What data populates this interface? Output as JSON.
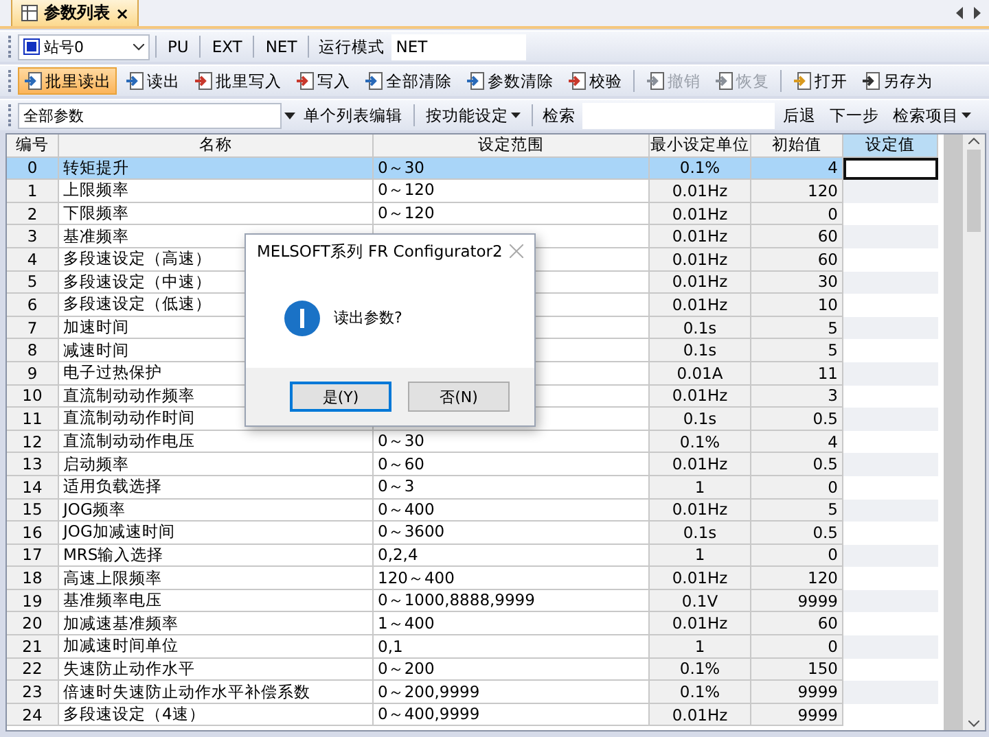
{
  "tab": {
    "title": "参数列表",
    "close": "×"
  },
  "mode_bar": {
    "station": "站号0",
    "modes": [
      "PU",
      "EXT",
      "NET"
    ],
    "mode_label": "运行模式",
    "mode_value": "NET"
  },
  "actions": [
    {
      "label": "批里读出",
      "selected": true,
      "disabled": false
    },
    {
      "label": "读出",
      "selected": false,
      "disabled": false
    },
    {
      "label": "批里写入",
      "selected": false,
      "disabled": false
    },
    {
      "label": "写入",
      "selected": false,
      "disabled": false
    },
    {
      "label": "全部清除",
      "selected": false,
      "disabled": false
    },
    {
      "label": "参数清除",
      "selected": false,
      "disabled": false
    },
    {
      "label": "校验",
      "selected": false,
      "disabled": false
    },
    {
      "label": "撤销",
      "selected": false,
      "disabled": true
    },
    {
      "label": "恢复",
      "selected": false,
      "disabled": true
    },
    {
      "label": "打开",
      "selected": false,
      "disabled": false
    },
    {
      "label": "另存为",
      "selected": false,
      "disabled": false
    }
  ],
  "filter_bar": {
    "group": "全部参数",
    "list_edit": "单个列表编辑",
    "by_function": "按功能设定",
    "search_label": "检索",
    "back": "后退",
    "next": "下一步",
    "search_items": "检索项目"
  },
  "table": {
    "columns": [
      "编号",
      "名称",
      "设定范围",
      "最小设定单位",
      "初始值",
      "设定值"
    ],
    "rows": [
      {
        "no": "0",
        "name": "转矩提升",
        "range": "0～30",
        "unit": "0.1%",
        "initial": "4",
        "selected": true
      },
      {
        "no": "1",
        "name": "上限频率",
        "range": "0～120",
        "unit": "0.01Hz",
        "initial": "120",
        "selected": false
      },
      {
        "no": "2",
        "name": "下限频率",
        "range": "0～120",
        "unit": "0.01Hz",
        "initial": "0",
        "selected": false
      },
      {
        "no": "3",
        "name": "基准频率",
        "unit": "0.01Hz",
        "initial": "60",
        "selected": false
      },
      {
        "no": "4",
        "name": "多段速设定（高速）",
        "unit": "0.01Hz",
        "initial": "60",
        "selected": false
      },
      {
        "no": "5",
        "name": "多段速设定（中速）",
        "unit": "0.01Hz",
        "initial": "30",
        "selected": false
      },
      {
        "no": "6",
        "name": "多段速设定（低速）",
        "unit": "0.01Hz",
        "initial": "10",
        "selected": false
      },
      {
        "no": "7",
        "name": "加速时间",
        "unit": "0.1s",
        "initial": "5",
        "selected": false
      },
      {
        "no": "8",
        "name": "减速时间",
        "unit": "0.1s",
        "initial": "5",
        "selected": false
      },
      {
        "no": "9",
        "name": "电子过热保护",
        "unit": "0.01A",
        "initial": "11",
        "selected": false
      },
      {
        "no": "10",
        "name": "直流制动动作频率",
        "unit": "0.01Hz",
        "initial": "3",
        "selected": false
      },
      {
        "no": "11",
        "name": "直流制动动作时间",
        "unit": "0.1s",
        "initial": "0.5",
        "selected": false
      },
      {
        "no": "12",
        "name": "直流制动动作电压",
        "range": "0～30",
        "unit": "0.1%",
        "initial": "4",
        "selected": false
      },
      {
        "no": "13",
        "name": "启动频率",
        "range": "0～60",
        "unit": "0.01Hz",
        "initial": "0.5",
        "selected": false
      },
      {
        "no": "14",
        "name": "适用负载选择",
        "range": "0～3",
        "unit": "1",
        "initial": "0",
        "selected": false
      },
      {
        "no": "15",
        "name": "JOG频率",
        "range": "0～400",
        "unit": "0.01Hz",
        "initial": "5",
        "selected": false
      },
      {
        "no": "16",
        "name": "JOG加减速时间",
        "range": "0～3600",
        "unit": "0.1s",
        "initial": "0.5",
        "selected": false
      },
      {
        "no": "17",
        "name": "MRS输入选择",
        "range": "0,2,4",
        "unit": "1",
        "initial": "0",
        "selected": false
      },
      {
        "no": "18",
        "name": "高速上限频率",
        "range": "120～400",
        "unit": "0.01Hz",
        "initial": "120",
        "selected": false
      },
      {
        "no": "19",
        "name": "基准频率电压",
        "range": "0～1000,8888,9999",
        "unit": "0.1V",
        "initial": "9999",
        "selected": false
      },
      {
        "no": "20",
        "name": "加减速基准频率",
        "range": "1～400",
        "unit": "0.01Hz",
        "initial": "60",
        "selected": false
      },
      {
        "no": "21",
        "name": "加减速时间单位",
        "range": "0,1",
        "unit": "1",
        "initial": "0",
        "selected": false
      },
      {
        "no": "22",
        "name": "失速防止动作水平",
        "range": "0～200",
        "unit": "0.1%",
        "initial": "150",
        "selected": false
      },
      {
        "no": "23",
        "name": "倍速时失速防止动作水平补偿系数",
        "range": "0～200,9999",
        "unit": "0.1%",
        "initial": "9999",
        "selected": false
      },
      {
        "no": "24",
        "name": "多段速设定（4速）",
        "range": "0～400,9999",
        "unit": "0.01Hz",
        "initial": "9999",
        "selected": false
      }
    ]
  },
  "dialog": {
    "title": "MELSOFT系列 FR Configurator2",
    "message": "读出参数?",
    "buttons": [
      {
        "label": "是(Y)",
        "default": true
      },
      {
        "label": "否(N)",
        "default": false
      }
    ]
  }
}
